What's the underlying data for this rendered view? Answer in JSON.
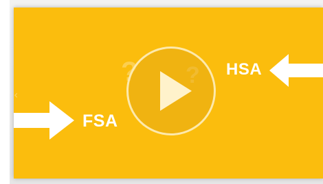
{
  "video": {
    "labels": {
      "left": "FSA",
      "right": "HSA"
    },
    "question_marks": [
      "?",
      "?"
    ],
    "prev_chevron": "‹",
    "colors": {
      "background": "#fbbd0d",
      "text": "#ffffff",
      "play_ring": "#fff0be"
    },
    "icons": {
      "play": "play-icon",
      "arrow_left": "arrow-right-icon",
      "arrow_right": "arrow-left-icon"
    }
  }
}
